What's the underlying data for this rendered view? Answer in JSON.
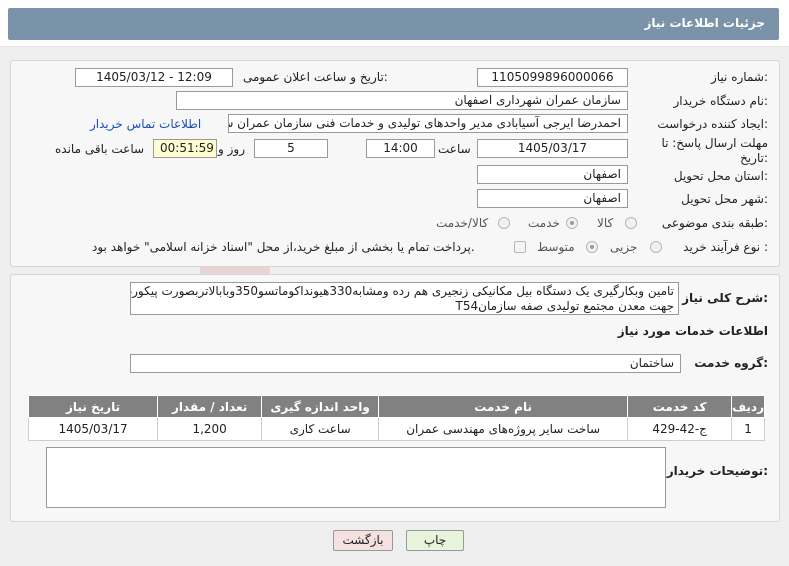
{
  "page": {
    "title": "جزئیات اطلاعات نیاز"
  },
  "form": {
    "need_number_label": "شماره نیاز:",
    "need_number": "1105099896000066",
    "announce_datetime_label": "تاریخ و ساعت اعلان عمومی:",
    "announce_datetime": "1405/03/12 - 12:09",
    "buyer_org_label": "نام دستگاه خریدار:",
    "buyer_org": "سازمان عمران شهرداری اصفهان",
    "requester_label": "ایجاد کننده درخواست:",
    "requester": "احمدرضا ایرجی آسیابادی مدیر واحدهای تولیدی و خدمات فنی سازمان عمران ش",
    "contact_link": "اطلاعات تماس خریدار",
    "deadline_label_line1": "مهلت ارسال پاسخ: تا",
    "deadline_label_line2": "تاریخ:",
    "deadline_date": "1405/03/17",
    "time_label": "ساعت",
    "deadline_time": "14:00",
    "days_value": "5",
    "days_label": "روز و",
    "remaining_time": "00:51:59",
    "remaining_label": "ساعت باقی مانده",
    "province_label": "استان محل تحویل:",
    "province": "اصفهان",
    "city_label": "شهر محل تحویل:",
    "city": "اصفهان",
    "category_label": "طبقه بندی موضوعی:",
    "category_options": [
      "کالا",
      "خدمت",
      "کالا/خدمت"
    ],
    "category_selected": "خدمت",
    "process_label": "نوع فرآیند خرید :",
    "process_options": [
      "جزیی",
      "متوسط"
    ],
    "process_selected": "متوسط",
    "payment_note": "پرداخت تمام یا بخشی از مبلغ خرید،از محل \"اسناد خزانه اسلامی\" خواهد بود."
  },
  "summary": {
    "label": "شرح کلی نیاز:",
    "line1": "تامین وبکارگیری یک دستگاه بیل مکانیکی زنجیری هم رده ومشابه330هیونداکوماتسو350وبابالاتربصورت پیکوردار",
    "line2": "جهت معدن مجتمع تولیدی صفه سازمانT54"
  },
  "services": {
    "section_title": "اطلاعات خدمات مورد نیاز",
    "group_label": "گروه خدمت:",
    "group_value": "ساختمان",
    "columns": [
      "ردیف",
      "کد خدمت",
      "نام خدمت",
      "واحد اندازه گیری",
      "تعداد / مقدار",
      "تاریخ نیاز"
    ],
    "rows": [
      {
        "row": "1",
        "code": "ج-42-429",
        "name": "ساخت سایر پروژه‌های مهندسی عمران",
        "unit": "ساعت کاری",
        "qty": "1,200",
        "date": "1405/03/17"
      }
    ]
  },
  "buyer_notes": {
    "label": "توضیحات خریدار:",
    "value": ""
  },
  "buttons": {
    "print": "چاپ",
    "back": "بازگشت"
  },
  "watermark": {
    "text": "AriaTender.net"
  },
  "colors": {
    "header": "#7a93a8",
    "table_header": "#818181",
    "link": "#1a4fb3",
    "watermark": "#c62828"
  }
}
